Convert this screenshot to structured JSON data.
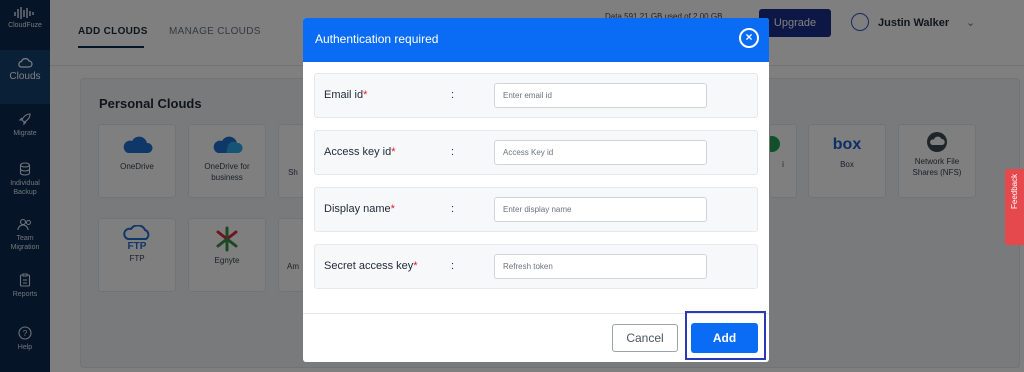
{
  "brand": {
    "name": "CloudFuze"
  },
  "sidebar": {
    "items": [
      {
        "label": "Clouds",
        "icon": "cloud-icon",
        "active": true
      },
      {
        "label": "Migrate",
        "icon": "rocket-icon"
      },
      {
        "label": "Individual Backup",
        "icon": "database-icon"
      },
      {
        "label": "Team Migration",
        "icon": "users-icon"
      },
      {
        "label": "Reports",
        "icon": "clipboard-icon"
      },
      {
        "label": "Help",
        "icon": "help-icon"
      }
    ]
  },
  "header": {
    "tabs": [
      {
        "label": "ADD CLOUDS",
        "active": true
      },
      {
        "label": "MANAGE CLOUDS"
      }
    ],
    "usage_text": "Data 591.21 GB used of 2.00 GB",
    "upgrade_label": "Upgrade",
    "user_name": "Justin Walker"
  },
  "content": {
    "section_title": "Personal Clouds",
    "tiles": [
      {
        "label": "OneDrive",
        "icon": "onedrive-icon"
      },
      {
        "label": "OneDrive for business",
        "icon": "onedrive-business-icon"
      },
      {
        "label": "Sh",
        "icon": "sharepoint-icon"
      },
      {
        "label": "i",
        "icon": "generic-cloud-icon"
      },
      {
        "label": "Box",
        "icon": "box-logo-icon"
      },
      {
        "label": "Network File Shares (NFS)",
        "icon": "nfs-icon"
      },
      {
        "label": "FTP",
        "icon": "ftp-icon"
      },
      {
        "label": "Egnyte",
        "icon": "egnyte-icon"
      },
      {
        "label": "Am",
        "icon": "amazon-icon"
      }
    ]
  },
  "feedback_label": "Feedback",
  "modal": {
    "title": "Authentication required",
    "fields": [
      {
        "label": "Email id",
        "placeholder": "Enter email id",
        "required": "*"
      },
      {
        "label": "Access key id",
        "placeholder": "Access Key id",
        "required": "*"
      },
      {
        "label": "Display name",
        "placeholder": "Enter display name",
        "required": "*"
      },
      {
        "label": "Secret access key",
        "placeholder": "Refresh token",
        "required": "*"
      }
    ],
    "colon": ":",
    "cancel_label": "Cancel",
    "add_label": "Add"
  },
  "colors": {
    "sidebar_bg": "#0b2a4f",
    "primary": "#0a6cf5",
    "upgrade": "#1a2f8a",
    "required": "#e11d2a",
    "feedback": "#e5484d"
  }
}
